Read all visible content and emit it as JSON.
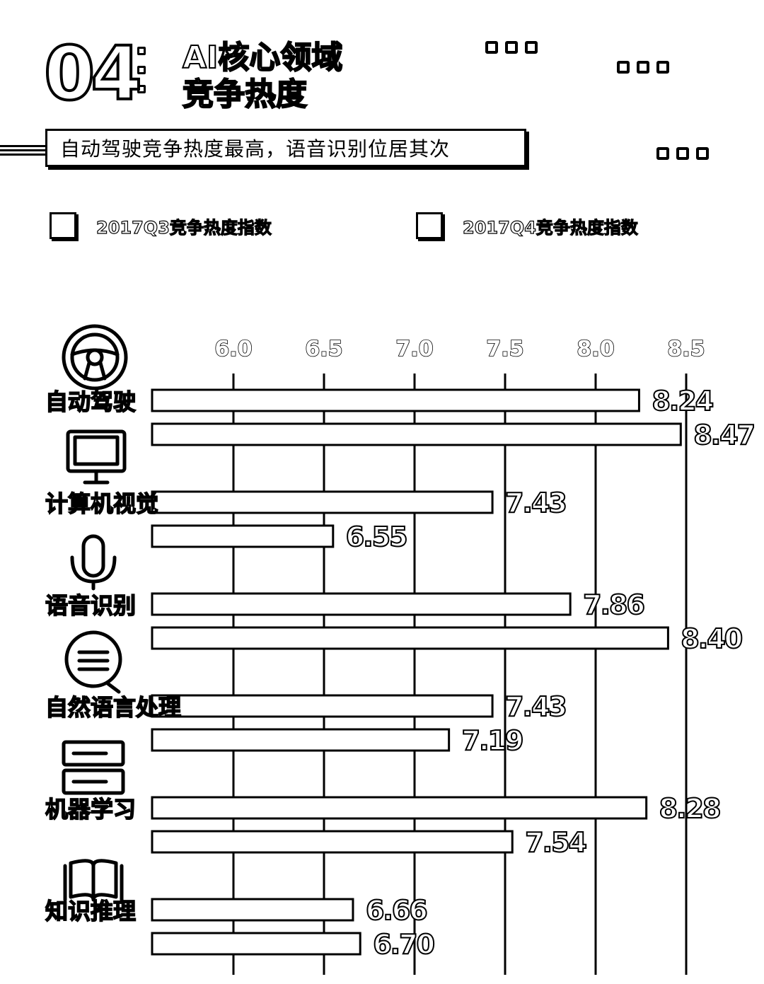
{
  "header": {
    "number": "04",
    "title_line1": "AI核心领域",
    "title_line2": "竞争热度",
    "subtitle": "自动驾驶竞争热度最高，语音识别位居其次"
  },
  "legend": [
    {
      "label": "2017Q3竞争热度指数"
    },
    {
      "label": "2017Q4竞争热度指数"
    }
  ],
  "icons": [
    "steering-wheel-icon",
    "monitor-icon",
    "microphone-icon",
    "speech-bubble-icon",
    "server-icon",
    "book-icon"
  ],
  "chart_data": {
    "type": "bar",
    "orientation": "horizontal",
    "categories": [
      "自动驾驶",
      "计算机视觉",
      "语音识别",
      "自然语言处理",
      "机器学习",
      "知识推理"
    ],
    "series": [
      {
        "name": "2017Q3竞争热度指数",
        "values": [
          8.24,
          7.43,
          7.86,
          7.43,
          8.28,
          6.66
        ]
      },
      {
        "name": "2017Q4竞争热度指数",
        "values": [
          8.47,
          6.55,
          8.4,
          7.19,
          7.54,
          6.7
        ]
      }
    ],
    "value_labels": [
      [
        "8.24",
        "7.43",
        "7.86",
        "7.43",
        "8.28",
        "6.66"
      ],
      [
        "8.47",
        "6.55",
        "8.40",
        "7.19",
        "7.54",
        "6.70"
      ]
    ],
    "tick_labels": [
      "6.0",
      "6.5",
      "7.0",
      "7.5",
      "8.0",
      "8.5"
    ],
    "ticks": [
      6.0,
      6.5,
      7.0,
      7.5,
      8.0,
      8.5
    ],
    "xlim": [
      6.0,
      8.5
    ],
    "grid": true,
    "legend_position": "top"
  }
}
